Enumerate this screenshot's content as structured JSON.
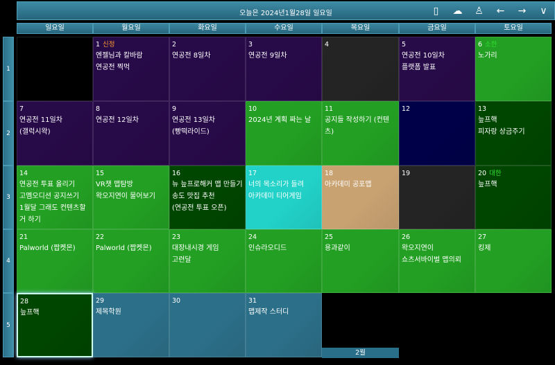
{
  "header": {
    "title": "오늘은 2024년1월28일 일요일",
    "icons": [
      {
        "name": "phone-icon",
        "glyph": "▯"
      },
      {
        "name": "cloud-check-icon",
        "glyph": "☁"
      },
      {
        "name": "user-icon",
        "glyph": "♙"
      },
      {
        "name": "arrow-left-icon",
        "glyph": "←"
      },
      {
        "name": "arrow-right-icon",
        "glyph": "→"
      },
      {
        "name": "chevron-down-icon",
        "glyph": "∨"
      }
    ]
  },
  "weekdays": [
    "일요일",
    "월요일",
    "화요일",
    "수요일",
    "목요일",
    "금요일",
    "토요일"
  ],
  "weeks": [
    "1",
    "2",
    "3",
    "4",
    "5"
  ],
  "month_label": "2월",
  "colors": {
    "purple": "#270a48",
    "green": "#23a023",
    "darkgreen": "#004500",
    "black": "#000000",
    "gray": "#242424",
    "navy": "#000048",
    "cyan": "#22d2c8",
    "tan": "#c9a272",
    "blue": "#2c6f88"
  },
  "cells": [
    {
      "w": 0,
      "d": 0,
      "num": "",
      "color": "black",
      "events": []
    },
    {
      "w": 0,
      "d": 1,
      "num": "1",
      "holiday": "신정",
      "holiday_color": "#ff9a30",
      "color": "purple",
      "events": [
        "엔젤님과 칼바람",
        "연공전 찍먹"
      ]
    },
    {
      "w": 0,
      "d": 2,
      "num": "2",
      "color": "purple",
      "events": [
        "연공전 8일차"
      ]
    },
    {
      "w": 0,
      "d": 3,
      "num": "3",
      "color": "purple",
      "events": [
        "연공전 9일차"
      ]
    },
    {
      "w": 0,
      "d": 4,
      "num": "4",
      "color": "gray",
      "events": []
    },
    {
      "w": 0,
      "d": 5,
      "num": "5",
      "color": "purple",
      "events": [
        "연공전 10일차",
        "플랫폼 발표"
      ]
    },
    {
      "w": 0,
      "d": 6,
      "num": "6",
      "holiday": "소한",
      "holiday_color": "#30e030",
      "color": "green",
      "events": [
        "노가리"
      ]
    },
    {
      "w": 1,
      "d": 0,
      "num": "7",
      "color": "purple",
      "events": [
        "연공전 11일차",
        "(갤럭시왁)"
      ]
    },
    {
      "w": 1,
      "d": 1,
      "num": "8",
      "color": "purple",
      "events": [
        "연공전 12일차"
      ]
    },
    {
      "w": 1,
      "d": 2,
      "num": "9",
      "color": "purple",
      "events": [
        "연공전 13일차",
        "(빵떡라이드)"
      ]
    },
    {
      "w": 1,
      "d": 3,
      "num": "10",
      "color": "green",
      "events": [
        "2024년 계획 짜는 날"
      ]
    },
    {
      "w": 1,
      "d": 4,
      "num": "11",
      "color": "green",
      "events": [
        "공지들 작성하기 (컨텐츠)"
      ]
    },
    {
      "w": 1,
      "d": 5,
      "num": "12",
      "color": "navy",
      "events": []
    },
    {
      "w": 1,
      "d": 6,
      "num": "13",
      "color": "darkgreen",
      "events": [
        "늪프핵",
        "피자랑 상금주기"
      ]
    },
    {
      "w": 2,
      "d": 0,
      "num": "14",
      "color": "green",
      "events": [
        "연공전 투표 올리기",
        "고멤오디션 공지쓰기",
        "1월달 그래도 컨텐츠할거 하기"
      ]
    },
    {
      "w": 2,
      "d": 1,
      "num": "15",
      "color": "green",
      "events": [
        "VR챗 맵탐방",
        "왁오지연이 물어보기"
      ]
    },
    {
      "w": 2,
      "d": 2,
      "num": "16",
      "color": "darkgreen",
      "events": [
        "뉴 늪프로해커 맵 만들기",
        "송도 맛집 추천",
        "(연공전 투표 오픈)"
      ]
    },
    {
      "w": 2,
      "d": 3,
      "num": "17",
      "color": "cyan",
      "events": [
        "너의 목소리가 들려",
        "아카데미 티어게임"
      ]
    },
    {
      "w": 2,
      "d": 4,
      "num": "18",
      "color": "tan",
      "events": [
        "아카데미 공포맵"
      ]
    },
    {
      "w": 2,
      "d": 5,
      "num": "19",
      "color": "gray",
      "events": []
    },
    {
      "w": 2,
      "d": 6,
      "num": "20",
      "holiday": "대한",
      "holiday_color": "#30e030",
      "color": "darkgreen",
      "events": [
        "늪프핵"
      ]
    },
    {
      "w": 3,
      "d": 0,
      "num": "21",
      "color": "green",
      "events": [
        "Palworld (짭켓몬)"
      ]
    },
    {
      "w": 3,
      "d": 1,
      "num": "22",
      "color": "green",
      "events": [
        "Palworld (짭켓몬)"
      ]
    },
    {
      "w": 3,
      "d": 2,
      "num": "23",
      "color": "green",
      "events": [
        "대장내시경 게임",
        "고련달"
      ]
    },
    {
      "w": 3,
      "d": 3,
      "num": "24",
      "color": "green",
      "events": [
        "인슈라오디드"
      ]
    },
    {
      "w": 3,
      "d": 4,
      "num": "25",
      "color": "green",
      "events": [
        "용과같이"
      ]
    },
    {
      "w": 3,
      "d": 5,
      "num": "26",
      "color": "green",
      "events": [
        "왁오지연이",
        "쇼츠서바이벌 맵의뢰"
      ]
    },
    {
      "w": 3,
      "d": 6,
      "num": "27",
      "color": "green",
      "events": [
        "킹제"
      ]
    },
    {
      "w": 4,
      "d": 0,
      "num": "28",
      "color": "darkgreen",
      "today": true,
      "events": [
        "늪프핵"
      ]
    },
    {
      "w": 4,
      "d": 1,
      "num": "29",
      "color": "blue",
      "events": [
        "제목학원"
      ]
    },
    {
      "w": 4,
      "d": 2,
      "num": "30",
      "color": "blue",
      "events": []
    },
    {
      "w": 4,
      "d": 3,
      "num": "31",
      "color": "blue",
      "events": [
        "맵제작 스터디"
      ]
    }
  ]
}
